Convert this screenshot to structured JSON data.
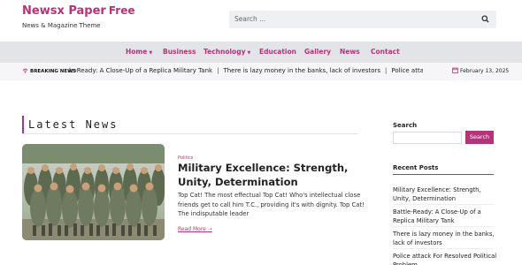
{
  "header": {
    "brand_main": "Newsx Paper",
    "brand_free": "Free",
    "tagline": "News & Magazine Theme",
    "search_placeholder": "Search ..."
  },
  "nav": {
    "items": [
      {
        "label": "Home",
        "dropdown": true
      },
      {
        "label": "Business",
        "dropdown": false
      },
      {
        "label": "Technology",
        "dropdown": true
      },
      {
        "label": "Education",
        "dropdown": false
      },
      {
        "label": "Gallery",
        "dropdown": false
      },
      {
        "label": "News",
        "dropdown": false
      },
      {
        "label": "Contact",
        "dropdown": false
      }
    ]
  },
  "ticker": {
    "label": "BREAKING NEWS",
    "items": [
      "le-Ready: A Close-Up of a Replica Military Tank",
      "There is lazy money in the banks, lack of investors",
      "Police attack For"
    ],
    "date": "February 13, 2025"
  },
  "main": {
    "section_title": "Latest News",
    "post": {
      "category": "Politics",
      "title": "Military Excellence: Strength, Unity, Determination",
      "excerpt": "Top Cat! The most effectual Top Cat! Who's intellectual close friends get to call him T.C., providing it's with dignity. Top Cat! The indisputable leader",
      "read_more": "Read More"
    }
  },
  "sidebar": {
    "search_label": "Search",
    "search_button": "Search",
    "recent_label": "Recent Posts",
    "recent_posts": [
      "Military Excellence: Strength, Unity, Determination",
      "Battle-Ready: A Close-Up of a Replica Military Tank",
      "There is lazy money in the banks, lack of investors",
      "Police attack For Resolved Political Problem"
    ]
  },
  "colors": {
    "accent": "#b5337a",
    "nav_bg": "#e3e4e8"
  }
}
